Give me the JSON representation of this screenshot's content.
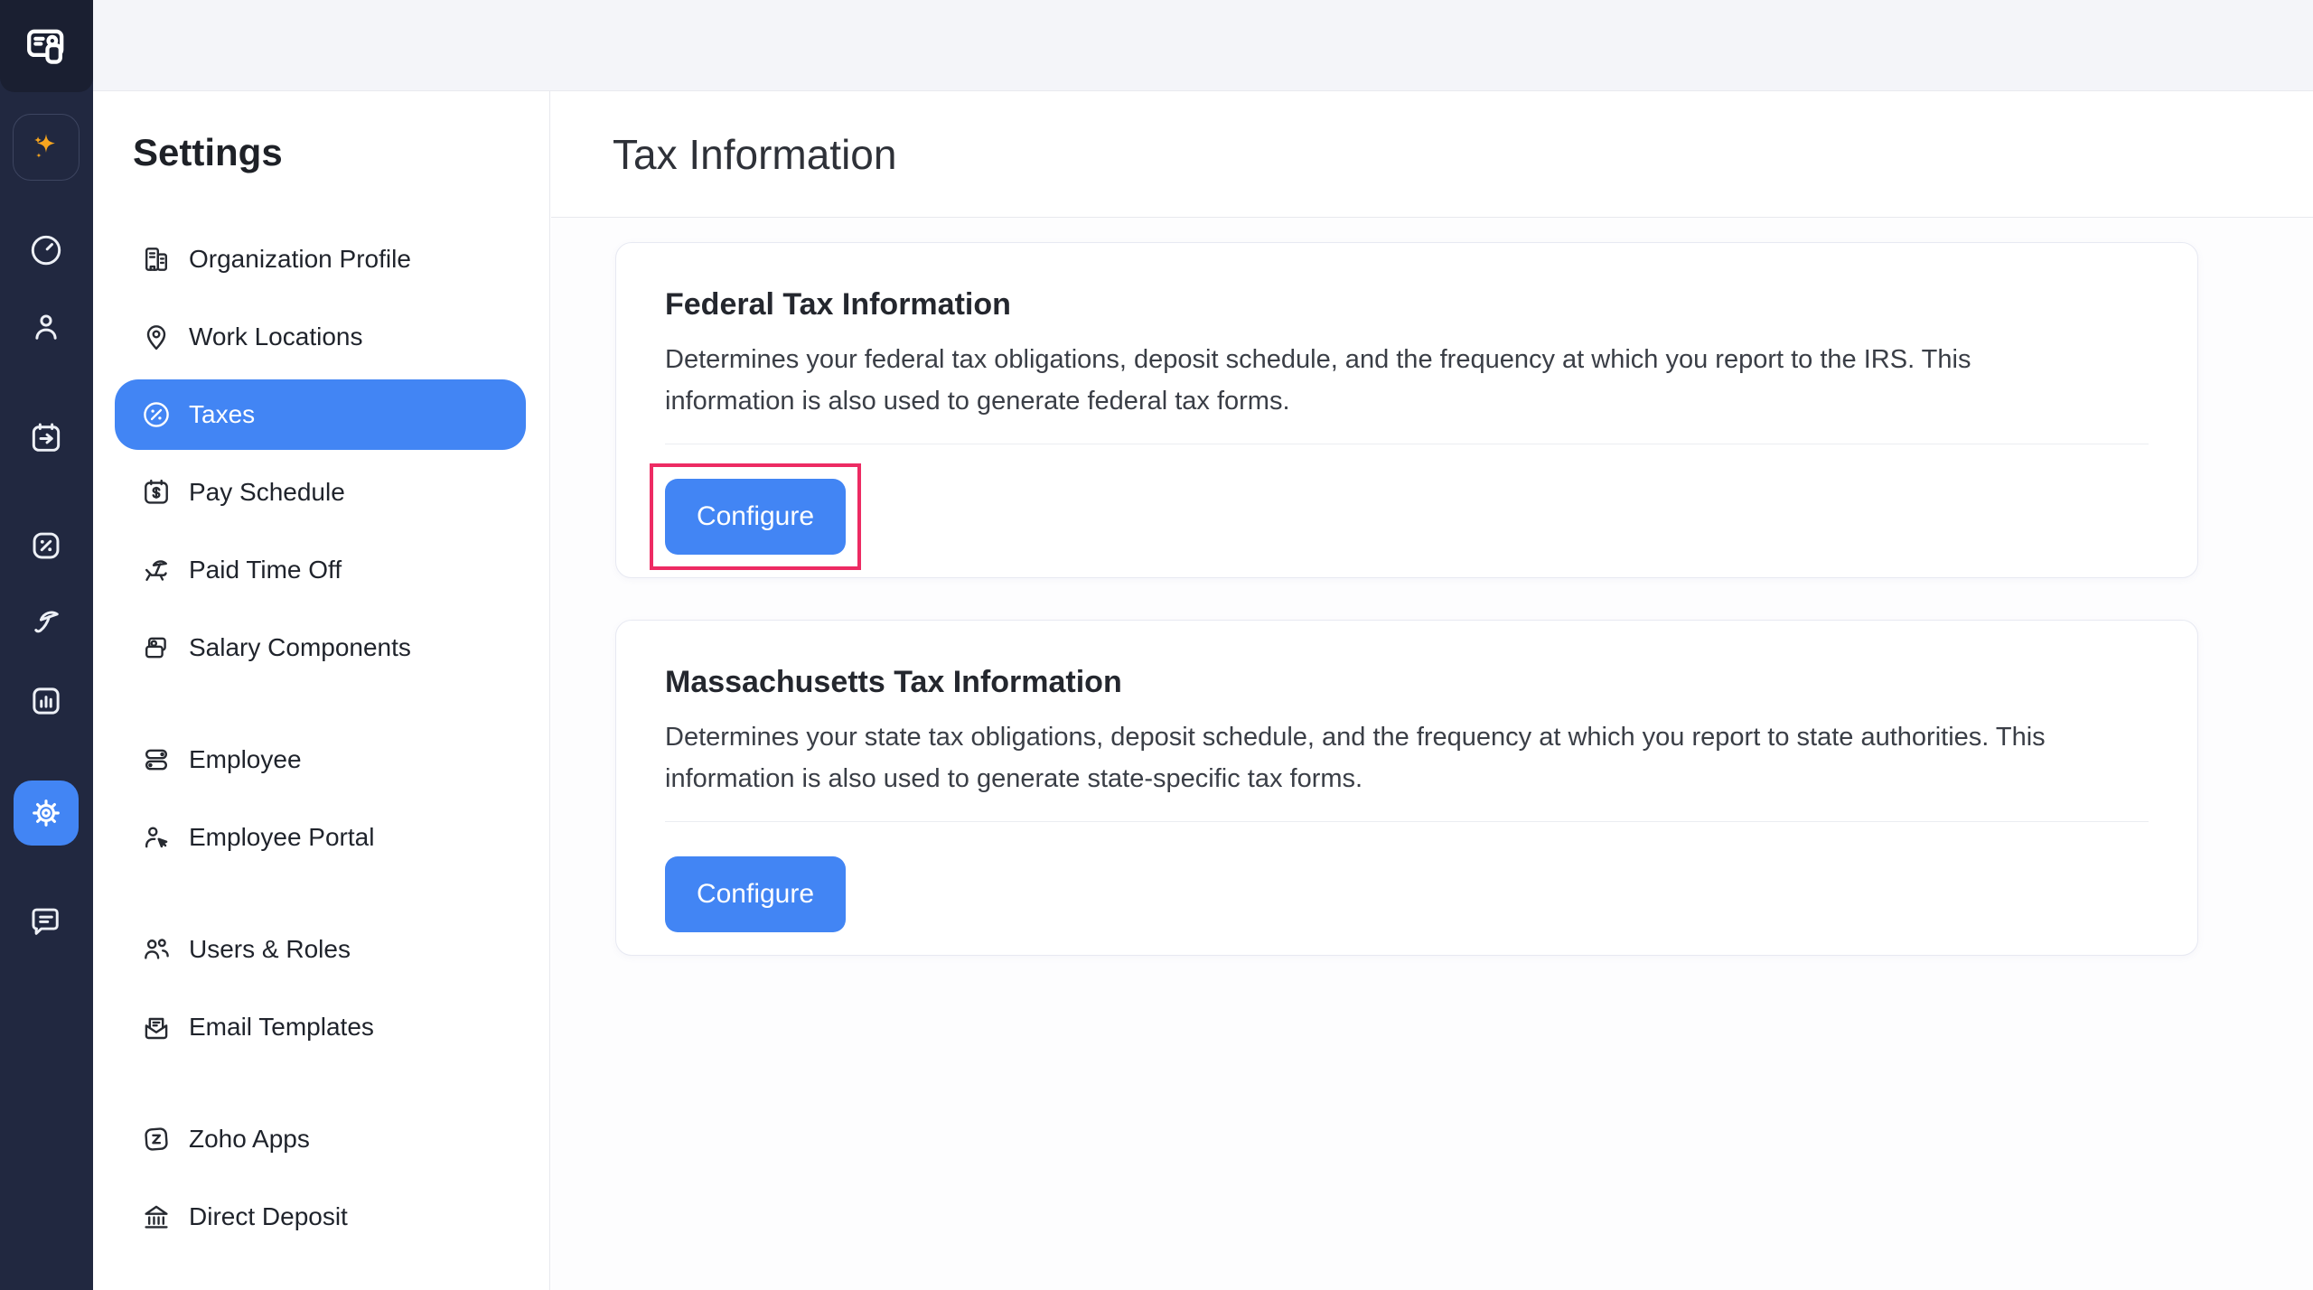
{
  "colors": {
    "accent_blue": "#4285F4",
    "sidebar_navy": "#212840",
    "sparkle_orange": "#F6A51F",
    "highlight_pink": "#ED2B63"
  },
  "rail": {
    "logo_icon": "payroll-card-logo",
    "items": [
      {
        "icon": "sparkle-ai"
      },
      {
        "icon": "dashboard-speedometer"
      },
      {
        "icon": "employees-person"
      },
      {
        "icon": "pay-runs-calendar-arrow"
      },
      {
        "icon": "taxes-percent-badge"
      },
      {
        "icon": "leave-umbrella"
      },
      {
        "icon": "reports-bar-chart"
      },
      {
        "icon": "settings-gear",
        "active": true
      },
      {
        "icon": "help-chat"
      }
    ]
  },
  "settings_nav": {
    "title": "Settings",
    "groups": [
      {
        "items": [
          {
            "label": "Organization Profile",
            "icon": "organization-building"
          },
          {
            "label": "Work Locations",
            "icon": "location-pin"
          },
          {
            "label": "Taxes",
            "icon": "percent-circle",
            "active": true
          },
          {
            "label": "Pay Schedule",
            "icon": "calendar-dollar"
          },
          {
            "label": "Paid Time Off",
            "icon": "beach-chair-umbrella"
          },
          {
            "label": "Salary Components",
            "icon": "wallet-cards"
          }
        ]
      },
      {
        "items": [
          {
            "label": "Employee",
            "icon": "toggle-switches"
          },
          {
            "label": "Employee Portal",
            "icon": "person-cursor"
          }
        ]
      },
      {
        "items": [
          {
            "label": "Users & Roles",
            "icon": "user-group"
          },
          {
            "label": "Email Templates",
            "icon": "mail-open-letter"
          }
        ]
      },
      {
        "items": [
          {
            "label": "Zoho Apps",
            "icon": "zoho-z-box"
          },
          {
            "label": "Direct Deposit",
            "icon": "bank"
          }
        ]
      }
    ]
  },
  "main": {
    "title": "Tax Information",
    "cards": [
      {
        "title": "Federal Tax Information",
        "description": "Determines your federal tax obligations, deposit schedule, and the frequency at which you report to the IRS. This information is also used to generate federal tax forms.",
        "button_label": "Configure",
        "highlighted": true
      },
      {
        "title": "Massachusetts Tax Information",
        "description": "Determines your state tax obligations, deposit schedule, and the frequency at which you report to state authorities. This information is also used to generate state-specific tax forms.",
        "button_label": "Configure",
        "highlighted": false
      }
    ]
  }
}
